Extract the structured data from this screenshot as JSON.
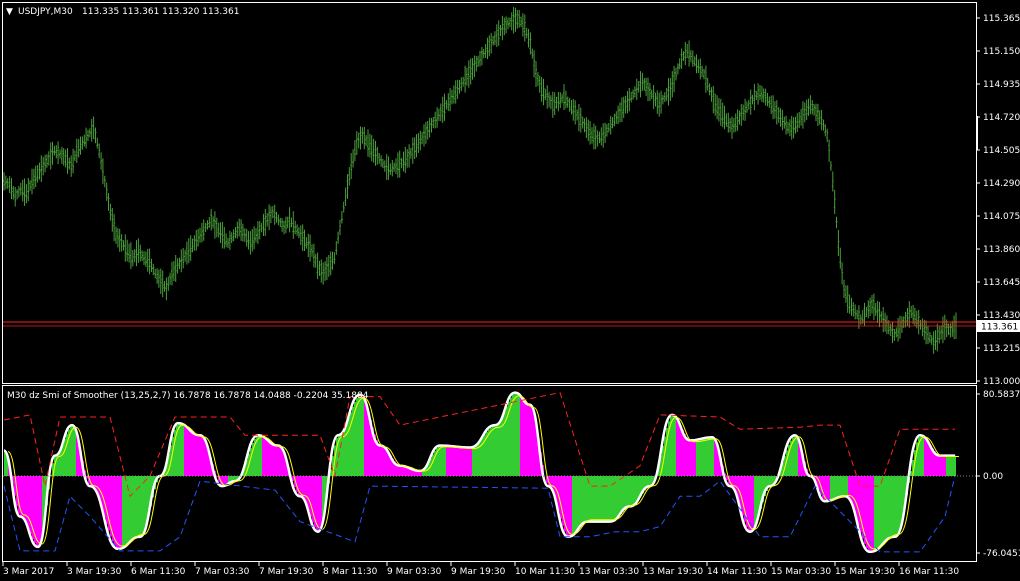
{
  "main_header": {
    "arrow": "▼",
    "symbol": "USDJPY,M30",
    "ohlc": "113.335 113.361 113.320 113.361"
  },
  "indicator_header": {
    "text": "M30 dz Smi of Smoother (13,25,2,7) 16.7878 16.7878 14.0488 -0.2204 35.1884"
  },
  "price_axis": {
    "labels": [
      "115.365",
      "115.150",
      "114.935",
      "114.720",
      "114.505",
      "114.290",
      "114.075",
      "113.860",
      "113.645",
      "113.430",
      "113.215",
      "113.000"
    ],
    "current_price": "113.361"
  },
  "indicator_axis": {
    "labels": [
      "80.5837",
      "0.00",
      "-76.0451"
    ]
  },
  "time_axis": {
    "labels": [
      "3 Mar 2017",
      "3 Mar 19:30",
      "6 Mar 11:30",
      "7 Mar 03:30",
      "7 Mar 19:30",
      "8 Mar 11:30",
      "9 Mar 03:30",
      "9 Mar 19:30",
      "10 Mar 11:30",
      "13 Mar 03:30",
      "13 Mar 19:30",
      "14 Mar 11:30",
      "15 Mar 03:30",
      "15 Mar 19:30",
      "16 Mar 11:30"
    ]
  },
  "colors": {
    "background": "#000000",
    "bars": "#4a9e3a",
    "hist_up": "#33cc33",
    "hist_down": "#ff00ff",
    "signal": "#ffffff",
    "signal2": "#ffff00",
    "upper_band": "#ff2020",
    "lower_band": "#2255ff",
    "price_line": "#ff2020",
    "axis": "#ffffff"
  },
  "chart_data": {
    "type": "line",
    "y_range": [
      113.0,
      115.365
    ],
    "close_series": [
      114.3,
      114.28,
      114.2,
      114.25,
      114.22,
      114.3,
      114.35,
      114.4,
      114.45,
      114.5,
      114.48,
      114.45,
      114.4,
      114.5,
      114.55,
      114.6,
      114.65,
      114.5,
      114.3,
      114.1,
      113.95,
      113.9,
      113.85,
      113.8,
      113.85,
      113.8,
      113.78,
      113.7,
      113.65,
      113.6,
      113.7,
      113.75,
      113.8,
      113.85,
      113.9,
      113.95,
      114.0,
      114.05,
      114.0,
      113.95,
      113.9,
      113.95,
      114.0,
      113.95,
      113.9,
      113.95,
      114.0,
      114.05,
      114.1,
      114.05,
      114.0,
      114.05,
      114.0,
      113.95,
      113.9,
      113.85,
      113.75,
      113.7,
      113.75,
      113.8,
      114.0,
      114.2,
      114.4,
      114.55,
      114.6,
      114.55,
      114.5,
      114.45,
      114.4,
      114.38,
      114.4,
      114.42,
      114.45,
      114.5,
      114.55,
      114.6,
      114.65,
      114.7,
      114.75,
      114.8,
      114.85,
      114.9,
      114.95,
      115.0,
      115.05,
      115.1,
      115.15,
      115.2,
      115.25,
      115.3,
      115.33,
      115.35,
      115.36,
      115.3,
      115.2,
      115.0,
      114.9,
      114.85,
      114.8,
      114.82,
      114.85,
      114.8,
      114.75,
      114.7,
      114.65,
      114.6,
      114.58,
      114.6,
      114.65,
      114.7,
      114.75,
      114.8,
      114.85,
      114.9,
      114.95,
      114.9,
      114.85,
      114.8,
      114.85,
      114.9,
      115.0,
      115.1,
      115.15,
      115.1,
      115.05,
      115.0,
      114.9,
      114.8,
      114.75,
      114.7,
      114.65,
      114.7,
      114.75,
      114.8,
      114.85,
      114.88,
      114.85,
      114.8,
      114.75,
      114.7,
      114.65,
      114.65,
      114.7,
      114.75,
      114.8,
      114.75,
      114.7,
      114.6,
      114.3,
      113.9,
      113.6,
      113.5,
      113.45,
      113.4,
      113.45,
      113.5,
      113.45,
      113.4,
      113.35,
      113.3,
      113.35,
      113.4,
      113.45,
      113.4,
      113.35,
      113.3,
      113.25,
      113.3,
      113.35,
      113.33,
      113.36
    ]
  }
}
